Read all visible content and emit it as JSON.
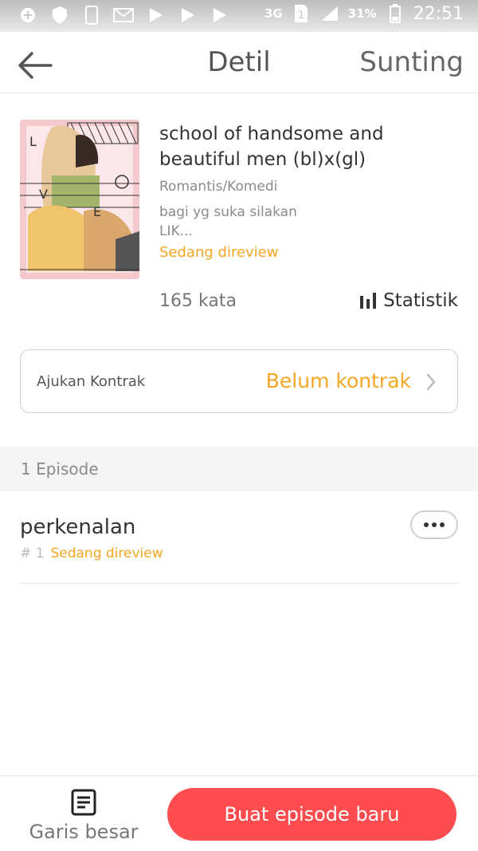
{
  "status_bar": {
    "network": "3G",
    "battery": "31%",
    "time": "22:51"
  },
  "header": {
    "title": "Detil",
    "edit_label": "Sunting"
  },
  "book": {
    "title": "school of handsome and beautiful men (bl)x(gl)",
    "genre": "Romantis/Komedi",
    "synopsis": "bagi yg suka silakan LIK...",
    "status": "Sedang direview",
    "word_count": "165 kata",
    "stats_label": "Statistik",
    "cover_letters": [
      "L",
      "O",
      "V",
      "E"
    ]
  },
  "contract": {
    "label": "Ajukan Kontrak",
    "value": "Belum kontrak"
  },
  "episodes": {
    "count_label": "1 Episode",
    "items": [
      {
        "title": "perkenalan",
        "number": "# 1",
        "status": "Sedang direview"
      }
    ]
  },
  "bottom_bar": {
    "outline_label": "Garis besar",
    "new_episode_label": "Buat episode baru"
  },
  "colors": {
    "accent_orange": "#f5a623",
    "primary_red": "#ff4d4f",
    "cover_pink": "#f3c9cd"
  }
}
